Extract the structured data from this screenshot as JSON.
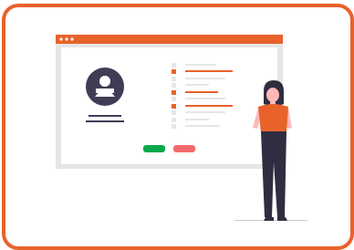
{
  "illustration": {
    "accent_color": "#e8622a",
    "window": {
      "titlebar_color": "#e8622a",
      "panel_color": "#f2f2f2",
      "dots": [
        "dot",
        "dot",
        "dot"
      ],
      "avatar": {
        "icon": "user-avatar-icon",
        "color": "#3f3d56"
      },
      "list_rows": [
        {
          "marker": "gray",
          "line": "short-gray"
        },
        {
          "marker": "orange",
          "line": "long-orange"
        },
        {
          "marker": "gray",
          "line": "medium-gray"
        },
        {
          "marker": "gray",
          "line": "short-gray"
        },
        {
          "marker": "orange",
          "line": "long-orange"
        },
        {
          "marker": "gray",
          "line": "medium-gray"
        },
        {
          "marker": "orange",
          "line": "long-orange"
        },
        {
          "marker": "gray",
          "line": "medium-gray"
        },
        {
          "marker": "gray",
          "line": "short-gray"
        },
        {
          "marker": "gray",
          "line": "medium-gray"
        }
      ],
      "buttons": [
        {
          "role": "confirm",
          "color": "#0aa74a"
        },
        {
          "role": "cancel",
          "color": "#f26b6b"
        }
      ]
    },
    "person": {
      "shirt_color": "#e8622a",
      "pants_color": "#2f2e41"
    }
  }
}
